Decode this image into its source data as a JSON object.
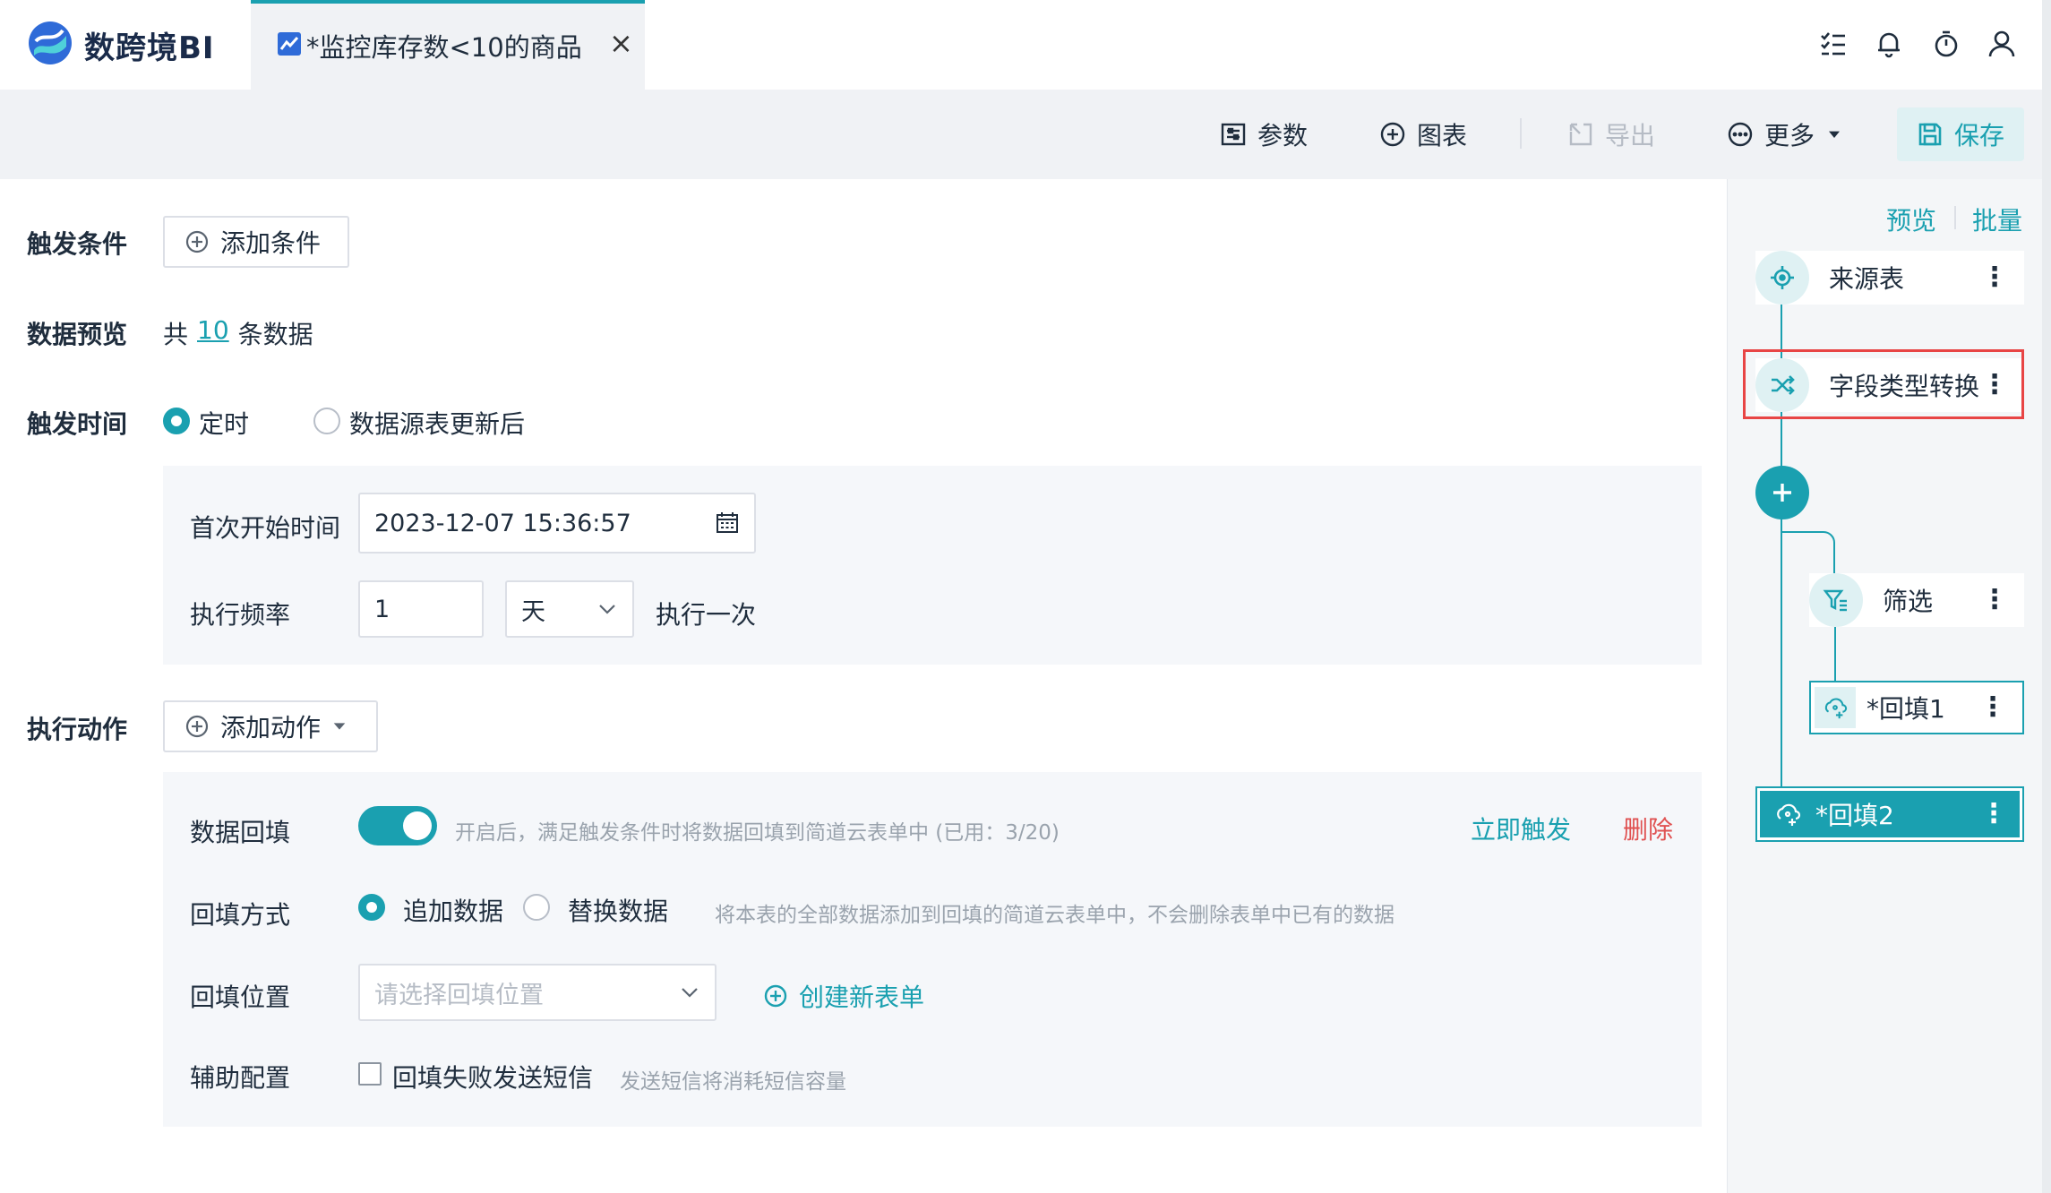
{
  "app": {
    "name": "数跨境BI"
  },
  "tab": {
    "title": "*监控库存数<10的商品"
  },
  "toolbar": {
    "params": "参数",
    "chart": "图表",
    "export": "导出",
    "more": "更多",
    "save": "保存"
  },
  "trigger": {
    "condition_label": "触发条件",
    "add_condition": "添加条件",
    "preview_label": "数据预览",
    "preview_prefix": "共",
    "preview_count": "10",
    "preview_suffix": "条数据",
    "time_label": "触发时间",
    "opt_scheduled": "定时",
    "opt_after_update": "数据源表更新后",
    "first_start_label": "首次开始时间",
    "first_start_value": "2023-12-07 15:36:57",
    "freq_label": "执行频率",
    "freq_value": "1",
    "freq_unit": "天",
    "freq_suffix": "执行一次"
  },
  "action": {
    "label": "执行动作",
    "add_action": "添加动作",
    "backfill_label": "数据回填",
    "backfill_enabled": true,
    "backfill_hint": "开启后，满足触发条件时将数据回填到简道云表单中 (已用：3/20)",
    "trigger_now": "立即触发",
    "delete": "删除",
    "mode_label": "回填方式",
    "mode_append": "追加数据",
    "mode_replace": "替换数据",
    "mode_hint": "将本表的全部数据添加到回填的简道云表单中，不会删除表单中已有的数据",
    "position_label": "回填位置",
    "position_placeholder": "请选择回填位置",
    "create_form": "创建新表单",
    "aux_label": "辅助配置",
    "aux_sms": "回填失败发送短信",
    "aux_hint": "发送短信将消耗短信容量"
  },
  "flow": {
    "preview": "预览",
    "batch": "批量",
    "source": "来源表",
    "convert": "字段类型转换",
    "filter": "筛选",
    "fill1": "*回填1",
    "fill2": "*回填2"
  },
  "colors": {
    "accent": "#1aa0b0",
    "danger": "#e05252",
    "highlight": "#e84545"
  }
}
